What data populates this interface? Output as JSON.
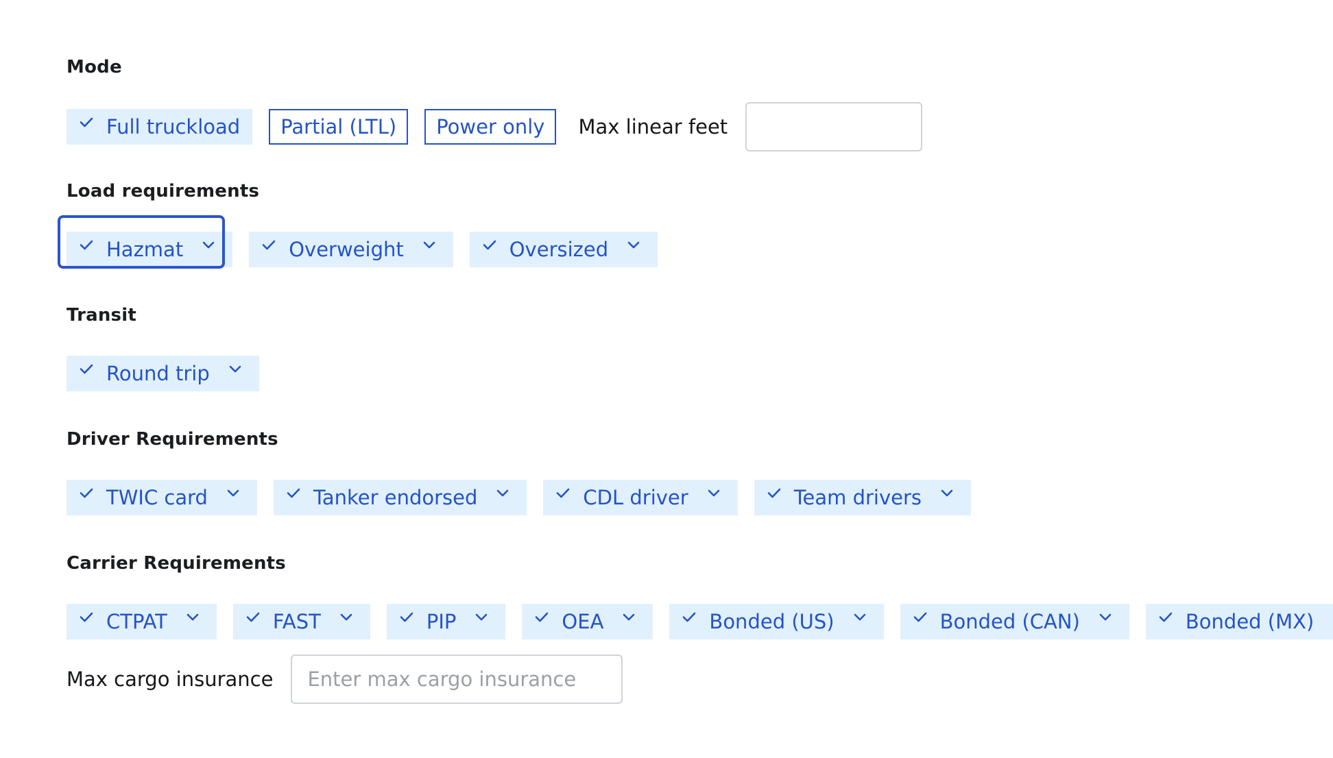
{
  "mode": {
    "label": "Mode",
    "options": [
      {
        "label": "Full truckload",
        "selected": true
      },
      {
        "label": "Partial (LTL)",
        "selected": false
      },
      {
        "label": "Power only",
        "selected": false
      }
    ],
    "max_linear_feet_label": "Max linear feet",
    "max_linear_feet_value": ""
  },
  "load_requirements": {
    "label": "Load requirements",
    "chips": [
      "Hazmat",
      "Overweight",
      "Oversized"
    ],
    "focused": "Hazmat"
  },
  "transit": {
    "label": "Transit",
    "chips": [
      "Round trip"
    ]
  },
  "driver_requirements": {
    "label": "Driver Requirements",
    "chips": [
      "TWIC card",
      "Tanker endorsed",
      "CDL driver",
      "Team drivers"
    ]
  },
  "carrier_requirements": {
    "label": "Carrier Requirements",
    "chips": [
      "CTPAT",
      "FAST",
      "PIP",
      "OEA",
      "Bonded (US)",
      "Bonded (CAN)",
      "Bonded (MX)"
    ],
    "max_cargo_insurance_label": "Max cargo insurance",
    "max_cargo_insurance_placeholder": "Enter max cargo insurance",
    "max_cargo_insurance_value": ""
  },
  "colors": {
    "chip_bg": "#e1f0fd",
    "chip_text": "#2453c8",
    "focus_ring": "#2a55cc"
  },
  "icons": {
    "selected": "check-icon",
    "dropdown": "chevron-down-icon"
  }
}
